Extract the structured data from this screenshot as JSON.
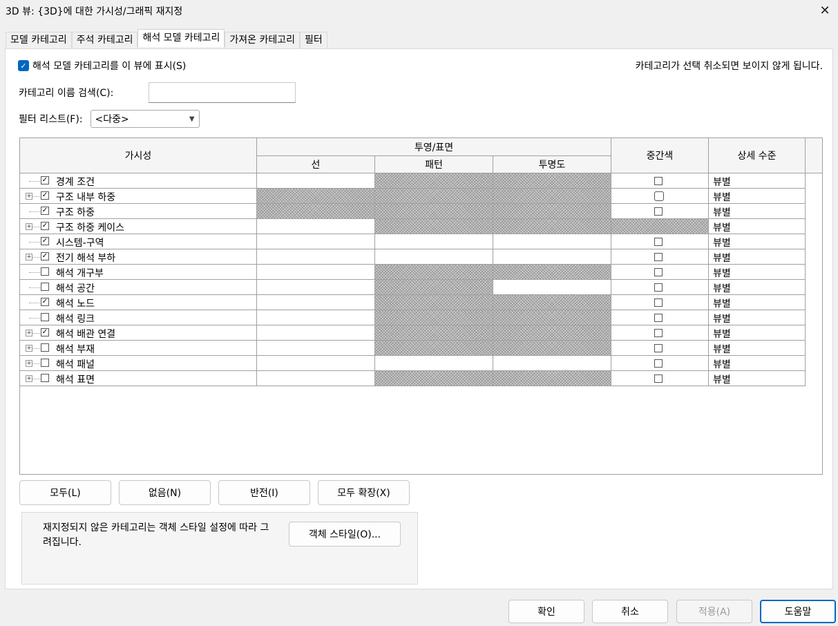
{
  "window": {
    "title": "3D 뷰: {3D}에 대한 가시성/그래픽 재지정"
  },
  "tabs": [
    {
      "label": "모델 카테고리"
    },
    {
      "label": "주석 카테고리"
    },
    {
      "label": "해석 모델 카테고리"
    },
    {
      "label": "가져온 카테고리"
    },
    {
      "label": "필터"
    }
  ],
  "active_tab": "해석 모델 카테고리",
  "show_checkbox": {
    "label": "해석 모델 카테고리를 이 뷰에 표시(S)",
    "checked": true
  },
  "hint": "카테고리가 선택 취소되면 보이지 않게 됩니다.",
  "search": {
    "label": "카테고리 이름 검색(C):",
    "value": ""
  },
  "filter": {
    "label": "필터 리스트(F):",
    "value": "<다중>"
  },
  "grid": {
    "headers": {
      "visibility": "가시성",
      "projection": "투영/표면",
      "line": "선",
      "pattern": "패턴",
      "transparency": "투명도",
      "halftone": "중간색",
      "detail": "상세 수준"
    },
    "rows": [
      {
        "name": "경계 조건",
        "checked": true,
        "expandable": false,
        "detail": "뷰별"
      },
      {
        "name": "구조 내부 하중",
        "checked": true,
        "expandable": true,
        "detail": "뷰별"
      },
      {
        "name": "구조 하중",
        "checked": true,
        "expandable": false,
        "detail": "뷰별"
      },
      {
        "name": "구조 하중 케이스",
        "checked": true,
        "expandable": true,
        "detail": "뷰별"
      },
      {
        "name": "시스템-구역",
        "checked": true,
        "expandable": false,
        "detail": "뷰별"
      },
      {
        "name": "전기 해석 부하",
        "checked": true,
        "expandable": true,
        "detail": "뷰별"
      },
      {
        "name": "해석 개구부",
        "checked": false,
        "expandable": false,
        "detail": "뷰별"
      },
      {
        "name": "해석 공간",
        "checked": false,
        "expandable": false,
        "detail": "뷰별"
      },
      {
        "name": "해석 노드",
        "checked": true,
        "expandable": false,
        "detail": "뷰별"
      },
      {
        "name": "해석 링크",
        "checked": false,
        "expandable": false,
        "detail": "뷰별"
      },
      {
        "name": "해석 배관 연결",
        "checked": true,
        "expandable": true,
        "detail": "뷰별"
      },
      {
        "name": "해석 부재",
        "checked": false,
        "expandable": true,
        "detail": "뷰별"
      },
      {
        "name": "해석 패널",
        "checked": false,
        "expandable": true,
        "detail": "뷰별"
      },
      {
        "name": "해석 표면",
        "checked": false,
        "expandable": true,
        "detail": "뷰별"
      }
    ]
  },
  "buttons": {
    "all": "모두(L)",
    "none": "없음(N)",
    "invert": "반전(I)",
    "expand_all": "모두 확장(X)",
    "object_styles": "객체 스타일(O)...",
    "ok": "확인",
    "cancel": "취소",
    "apply": "적용(A)",
    "help": "도움말"
  },
  "note": "재지정되지 않은 카테고리는 객체 스타일 설정에 따라 그려집니다.",
  "colors": {
    "accent": "#0067c0",
    "hatch": "#9a9a9a"
  }
}
